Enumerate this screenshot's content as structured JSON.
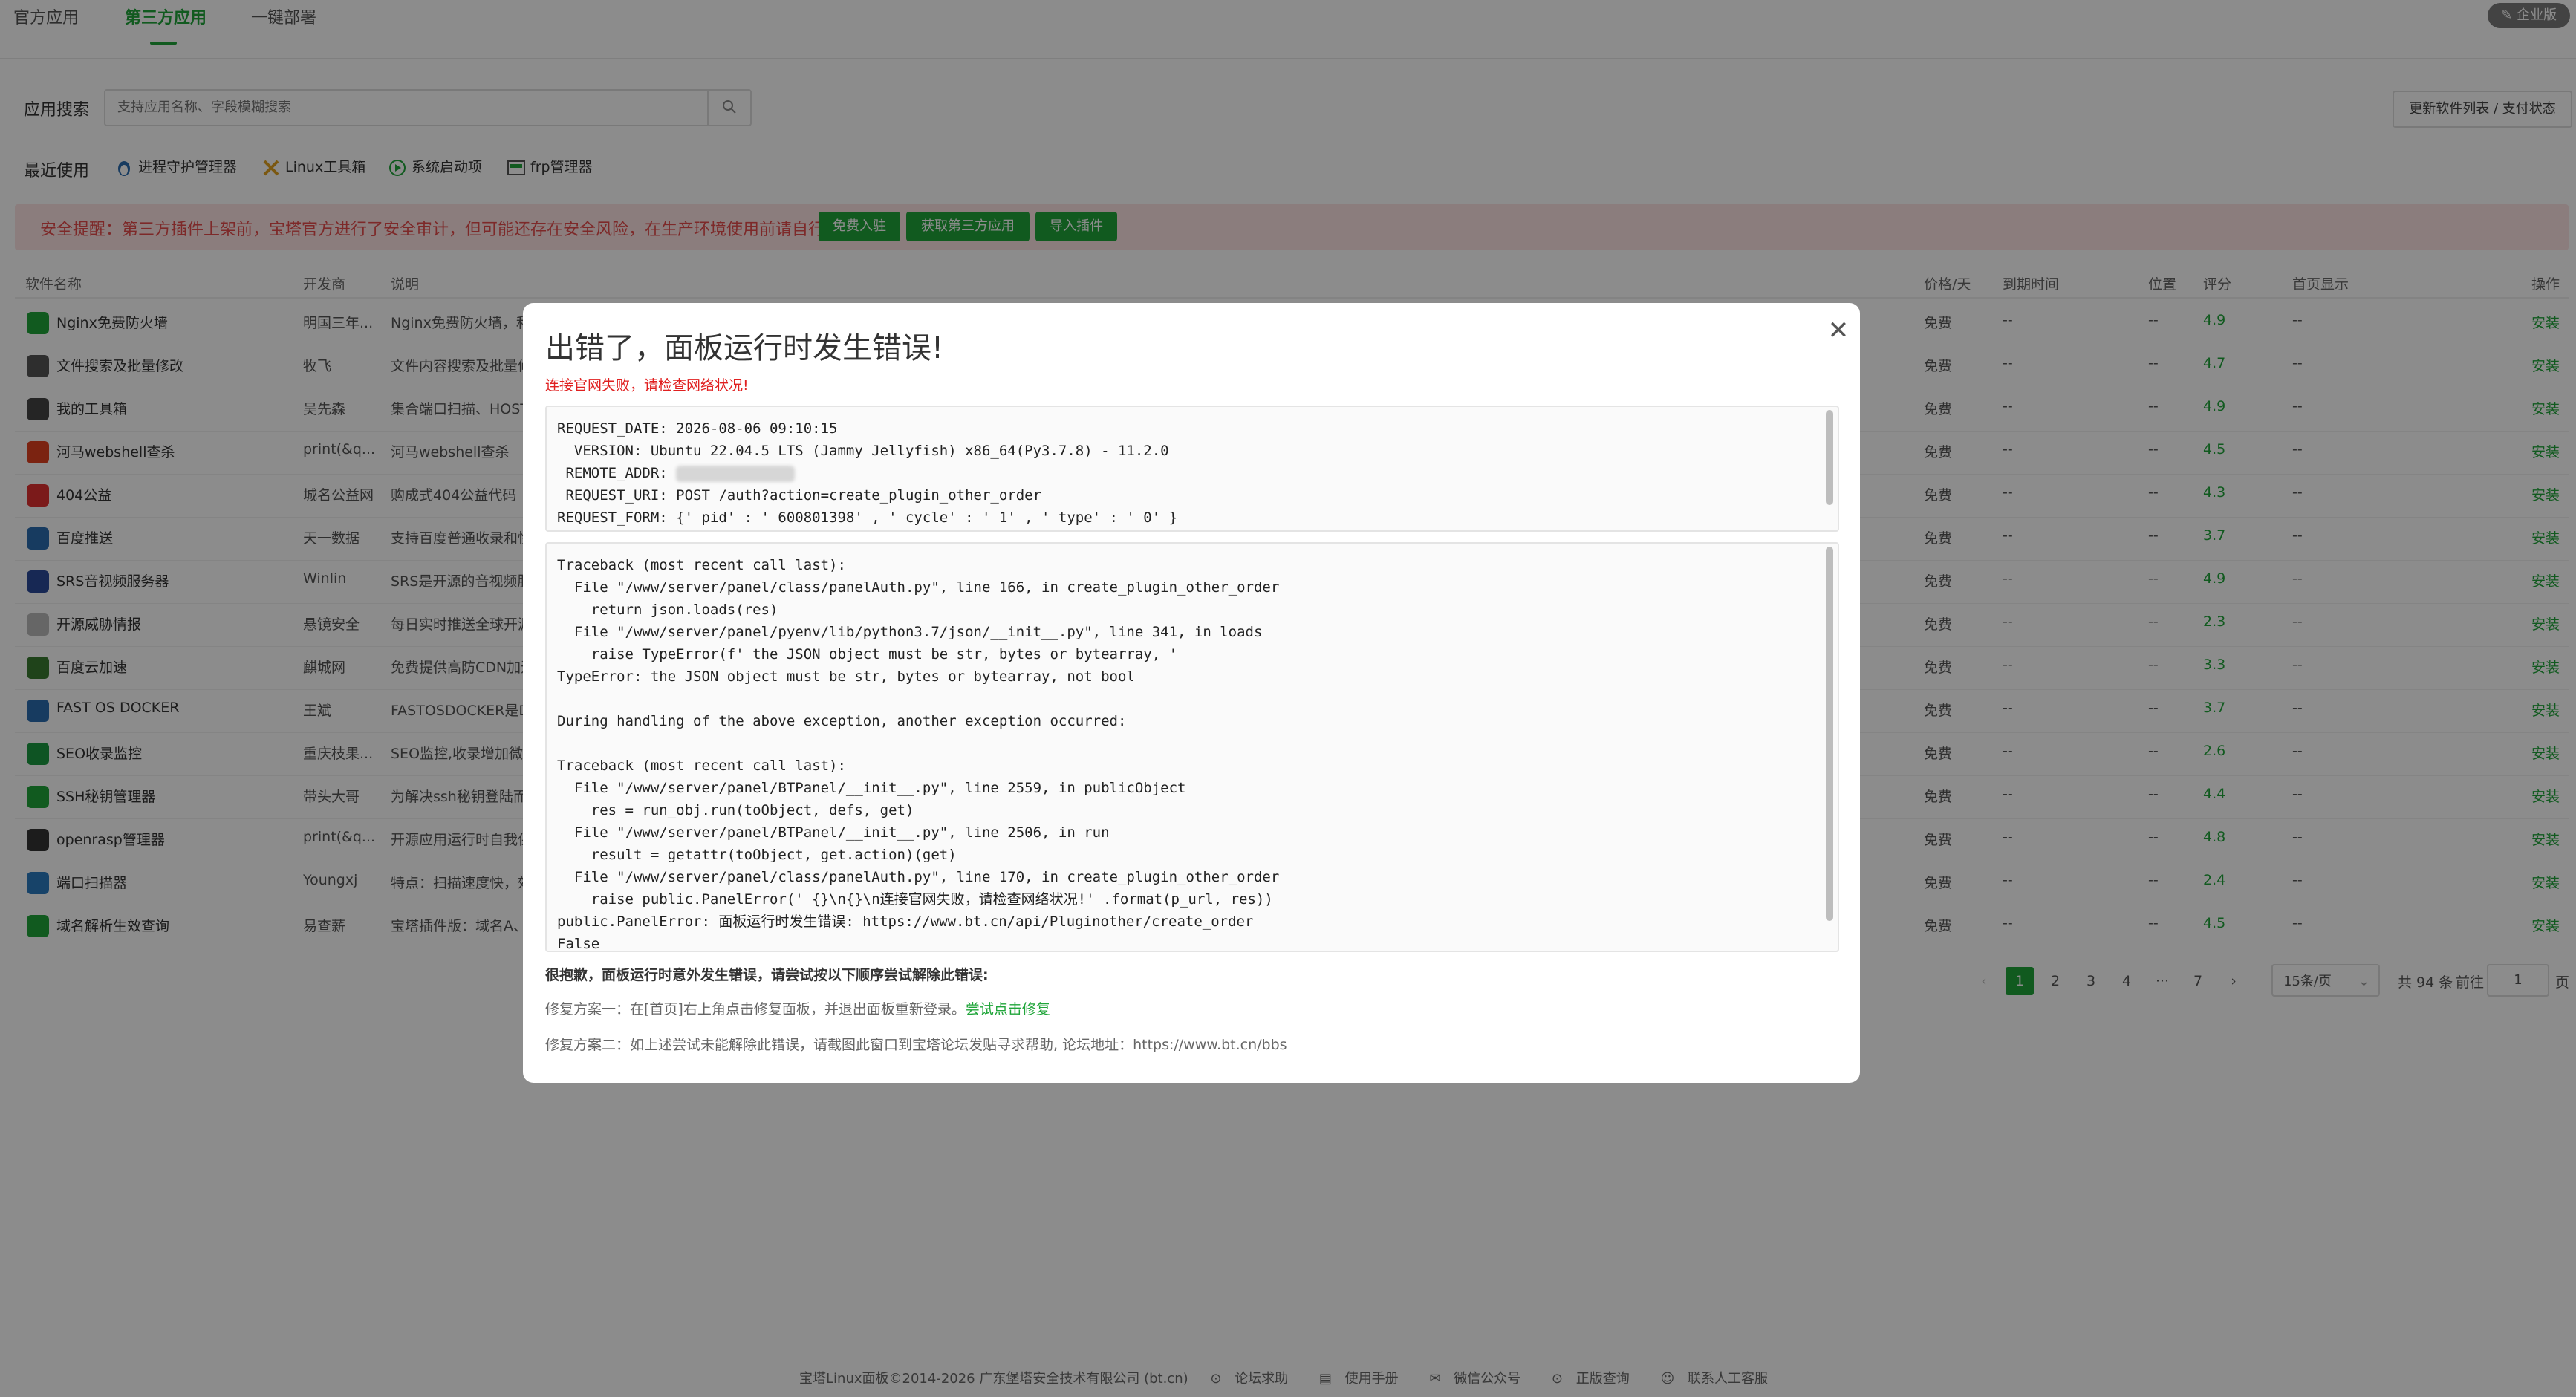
{
  "tabs": {
    "official": "官方应用",
    "third_party": "第三方应用",
    "deploy": "一键部署"
  },
  "badge": {
    "enterprise": "企业版"
  },
  "search": {
    "label": "应用搜索",
    "placeholder": "支持应用名称、字段模糊搜索"
  },
  "update_button": "更新软件列表 / 支付状态",
  "recent": {
    "label": "最近使用",
    "items": [
      "进程守护管理器",
      "Linux工具箱",
      "系统启动项",
      "frp管理器"
    ]
  },
  "alert": {
    "text": "安全提醒：第三方插件上架前，宝塔官方进行了安全审计，但可能还存在安全风险，在生产环境使用前请自行甄别",
    "btn_join": "免费入驻",
    "btn_get": "获取第三方应用",
    "btn_import": "导入插件"
  },
  "table": {
    "headers": {
      "name": "软件名称",
      "dev": "开发商",
      "desc": "说明",
      "price": "价格/天",
      "expire": "到期时间",
      "pos": "位置",
      "score": "评分",
      "home": "首页显示",
      "op": "操作"
    },
    "rows": [
      {
        "name": "Nginx免费防火墙",
        "dev": "明国三年...",
        "desc": "Nginx免费防火墙，和",
        "price": "免费",
        "expire": "--",
        "pos": "--",
        "score": "4.9",
        "home": "--",
        "op": "安装"
      },
      {
        "name": "文件搜索及批量修改",
        "dev": "牧飞",
        "desc": "文件内容搜索及批量修",
        "price": "免费",
        "expire": "--",
        "pos": "--",
        "score": "4.7",
        "home": "--",
        "op": "安装"
      },
      {
        "name": "我的工具箱",
        "dev": "吴先森",
        "desc": "集合端口扫描、HOST",
        "price": "免费",
        "expire": "--",
        "pos": "--",
        "score": "4.9",
        "home": "--",
        "op": "安装"
      },
      {
        "name": "河马webshell查杀",
        "dev": "print(&q...",
        "desc": "河马webshell查杀",
        "price": "免费",
        "expire": "--",
        "pos": "--",
        "score": "4.5",
        "home": "--",
        "op": "安装"
      },
      {
        "name": "404公益",
        "dev": "城名公益网",
        "desc": "购成式404公益代码",
        "price": "免费",
        "expire": "--",
        "pos": "--",
        "score": "4.3",
        "home": "--",
        "op": "安装"
      },
      {
        "name": "百度推送",
        "dev": "天一数据",
        "desc": "支持百度普通收录和快",
        "price": "免费",
        "expire": "--",
        "pos": "--",
        "score": "3.7",
        "home": "--",
        "op": "安装"
      },
      {
        "name": "SRS音视频服务器",
        "dev": "Winlin",
        "desc": "SRS是开源的音视频服",
        "price": "免费",
        "expire": "--",
        "pos": "--",
        "score": "4.9",
        "home": "--",
        "op": "安装"
      },
      {
        "name": "开源威胁情报",
        "dev": "悬镜安全",
        "desc": "每日实时推送全球开源",
        "price": "免费",
        "expire": "--",
        "pos": "--",
        "score": "2.3",
        "home": "--",
        "op": "安装"
      },
      {
        "name": "百度云加速",
        "dev": "麒城网",
        "desc": "免费提供高防CDN加速",
        "price": "免费",
        "expire": "--",
        "pos": "--",
        "score": "3.3",
        "home": "--",
        "op": "安装"
      },
      {
        "name": "FAST OS DOCKER",
        "dev": "王斌",
        "desc": "FASTOSDOCKER是Do",
        "price": "免费",
        "expire": "--",
        "pos": "--",
        "score": "3.7",
        "home": "--",
        "op": "安装"
      },
      {
        "name": "SEO收录监控",
        "dev": "重庆枝果...",
        "desc": "SEO监控,收录增加微信",
        "price": "免费",
        "expire": "--",
        "pos": "--",
        "score": "2.6",
        "home": "--",
        "op": "安装"
      },
      {
        "name": "SSH秘钥管理器",
        "dev": "带头大哥",
        "desc": "为解决ssh秘钥登陆而",
        "price": "免费",
        "expire": "--",
        "pos": "--",
        "score": "4.4",
        "home": "--",
        "op": "安装"
      },
      {
        "name": "openrasp管理器",
        "dev": "print(&q...",
        "desc": "开源应用运行时自我保",
        "price": "免费",
        "expire": "--",
        "pos": "--",
        "score": "4.8",
        "home": "--",
        "op": "安装"
      },
      {
        "name": "端口扫描器",
        "dev": "Youngxj",
        "desc": "特点：扫描速度快，效",
        "price": "免费",
        "expire": "--",
        "pos": "--",
        "score": "2.4",
        "home": "--",
        "op": "安装"
      },
      {
        "name": "域名解析生效查询",
        "dev": "易查薪",
        "desc": "宝塔插件版：域名A、",
        "price": "免费",
        "expire": "--",
        "pos": "--",
        "score": "4.5",
        "home": "--",
        "op": "安装"
      }
    ]
  },
  "pagination": {
    "pages": [
      "1",
      "2",
      "3",
      "4",
      "···",
      "7"
    ],
    "per_page": "15条/页",
    "total": "共 94 条",
    "goto": "前往",
    "goto_value": "1",
    "page_unit": "页"
  },
  "footer": {
    "copyright": "宝塔Linux面板©2014-2026 广东堡塔安全技术有限公司 (bt.cn)",
    "links": [
      "论坛求助",
      "使用手册",
      "微信公众号",
      "正版查询",
      "联系人工客服"
    ]
  },
  "modal": {
    "title": "出错了，面板运行时发生错误!",
    "subtitle": "连接官网失败，请检查网络状况!",
    "request": {
      "date": "REQUEST_DATE: 2026-08-06 09:10:15",
      "version": "  VERSION: Ubuntu 22.04.5 LTS (Jammy Jellyfish) x86_64(Py3.7.8) - 11.2.0",
      "remote": " REMOTE_ADDR: ",
      "uri": " REQUEST_URI: POST /auth?action=create_plugin_other_order",
      "form": "REQUEST_FORM: {' pid' : ' 600801398' , ' cycle' : ' 1' , ' type' : ' 0' }"
    },
    "traceback": "Traceback (most recent call last):\n  File \"/www/server/panel/class/panelAuth.py\", line 166, in create_plugin_other_order\n    return json.loads(res)\n  File \"/www/server/panel/pyenv/lib/python3.7/json/__init__.py\", line 341, in loads\n    raise TypeError(f' the JSON object must be str, bytes or bytearray, '\nTypeError: the JSON object must be str, bytes or bytearray, not bool\n\nDuring handling of the above exception, another exception occurred:\n\nTraceback (most recent call last):\n  File \"/www/server/panel/BTPanel/__init__.py\", line 2559, in publicObject\n    res = run_obj.run(toObject, defs, get)\n  File \"/www/server/panel/BTPanel/__init__.py\", line 2506, in run\n    result = getattr(toObject, get.action)(get)\n  File \"/www/server/panel/class/panelAuth.py\", line 170, in create_plugin_other_order\n    raise public.PanelError(' {}\\n{}\\n连接官网失败，请检查网络状况!' .format(p_url, res))\npublic.PanelError: 面板运行时发生错误: https://www.bt.cn/api/Pluginother/create_order\nFalse",
    "help_title": "很抱歉，面板运行时意外发生错误，请尝试按以下顺序尝试解除此错误:",
    "fix1_text": "修复方案一：在[首页]右上角点击修复面板，并退出面板重新登录。",
    "fix1_link": "尝试点击修复",
    "fix2_text": "修复方案二：如上述尝试未能解除此错误，请截图此窗口到宝塔论坛发贴寻求帮助, 论坛地址：https://www.bt.cn/bbs"
  },
  "colors": {
    "accent": "#20a53a",
    "danger": "#e02020",
    "alert_bg": "#fde3e3"
  }
}
